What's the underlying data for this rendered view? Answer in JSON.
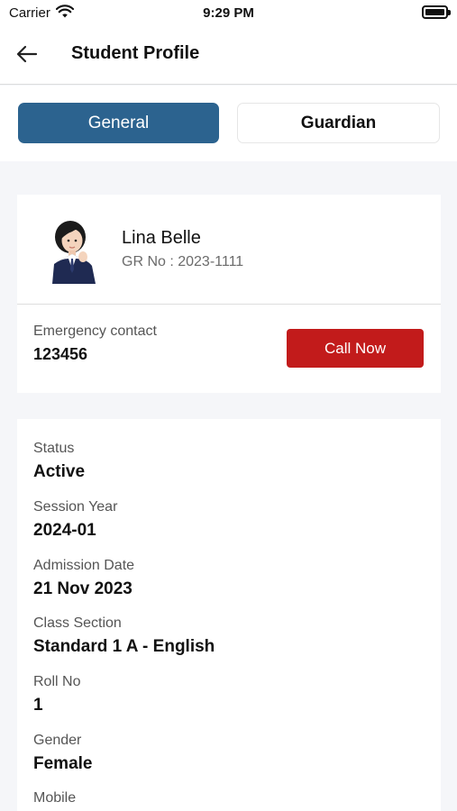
{
  "status_bar": {
    "carrier": "Carrier",
    "time": "9:29 PM"
  },
  "header": {
    "title": "Student Profile"
  },
  "tabs": [
    {
      "label": "General",
      "active": true
    },
    {
      "label": "Guardian",
      "active": false
    }
  ],
  "profile": {
    "name": "Lina Belle",
    "gr_number": "GR No : 2023-1111",
    "emergency_label": "Emergency contact",
    "emergency_value": "123456",
    "call_button": "Call Now"
  },
  "details": [
    {
      "label": "Status",
      "value": "Active"
    },
    {
      "label": "Session Year",
      "value": "2024-01"
    },
    {
      "label": "Admission Date",
      "value": "21 Nov 2023"
    },
    {
      "label": "Class Section",
      "value": "Standard 1 A - English"
    },
    {
      "label": "Roll No",
      "value": "1"
    },
    {
      "label": "Gender",
      "value": "Female"
    },
    {
      "label": "Mobile",
      "value": ""
    }
  ],
  "colors": {
    "primary": "#2c638f",
    "danger": "#c21b1b",
    "background": "#f5f6f9"
  },
  "icons": {
    "back": "arrow-left-icon",
    "wifi": "wifi-icon",
    "battery": "battery-icon"
  }
}
